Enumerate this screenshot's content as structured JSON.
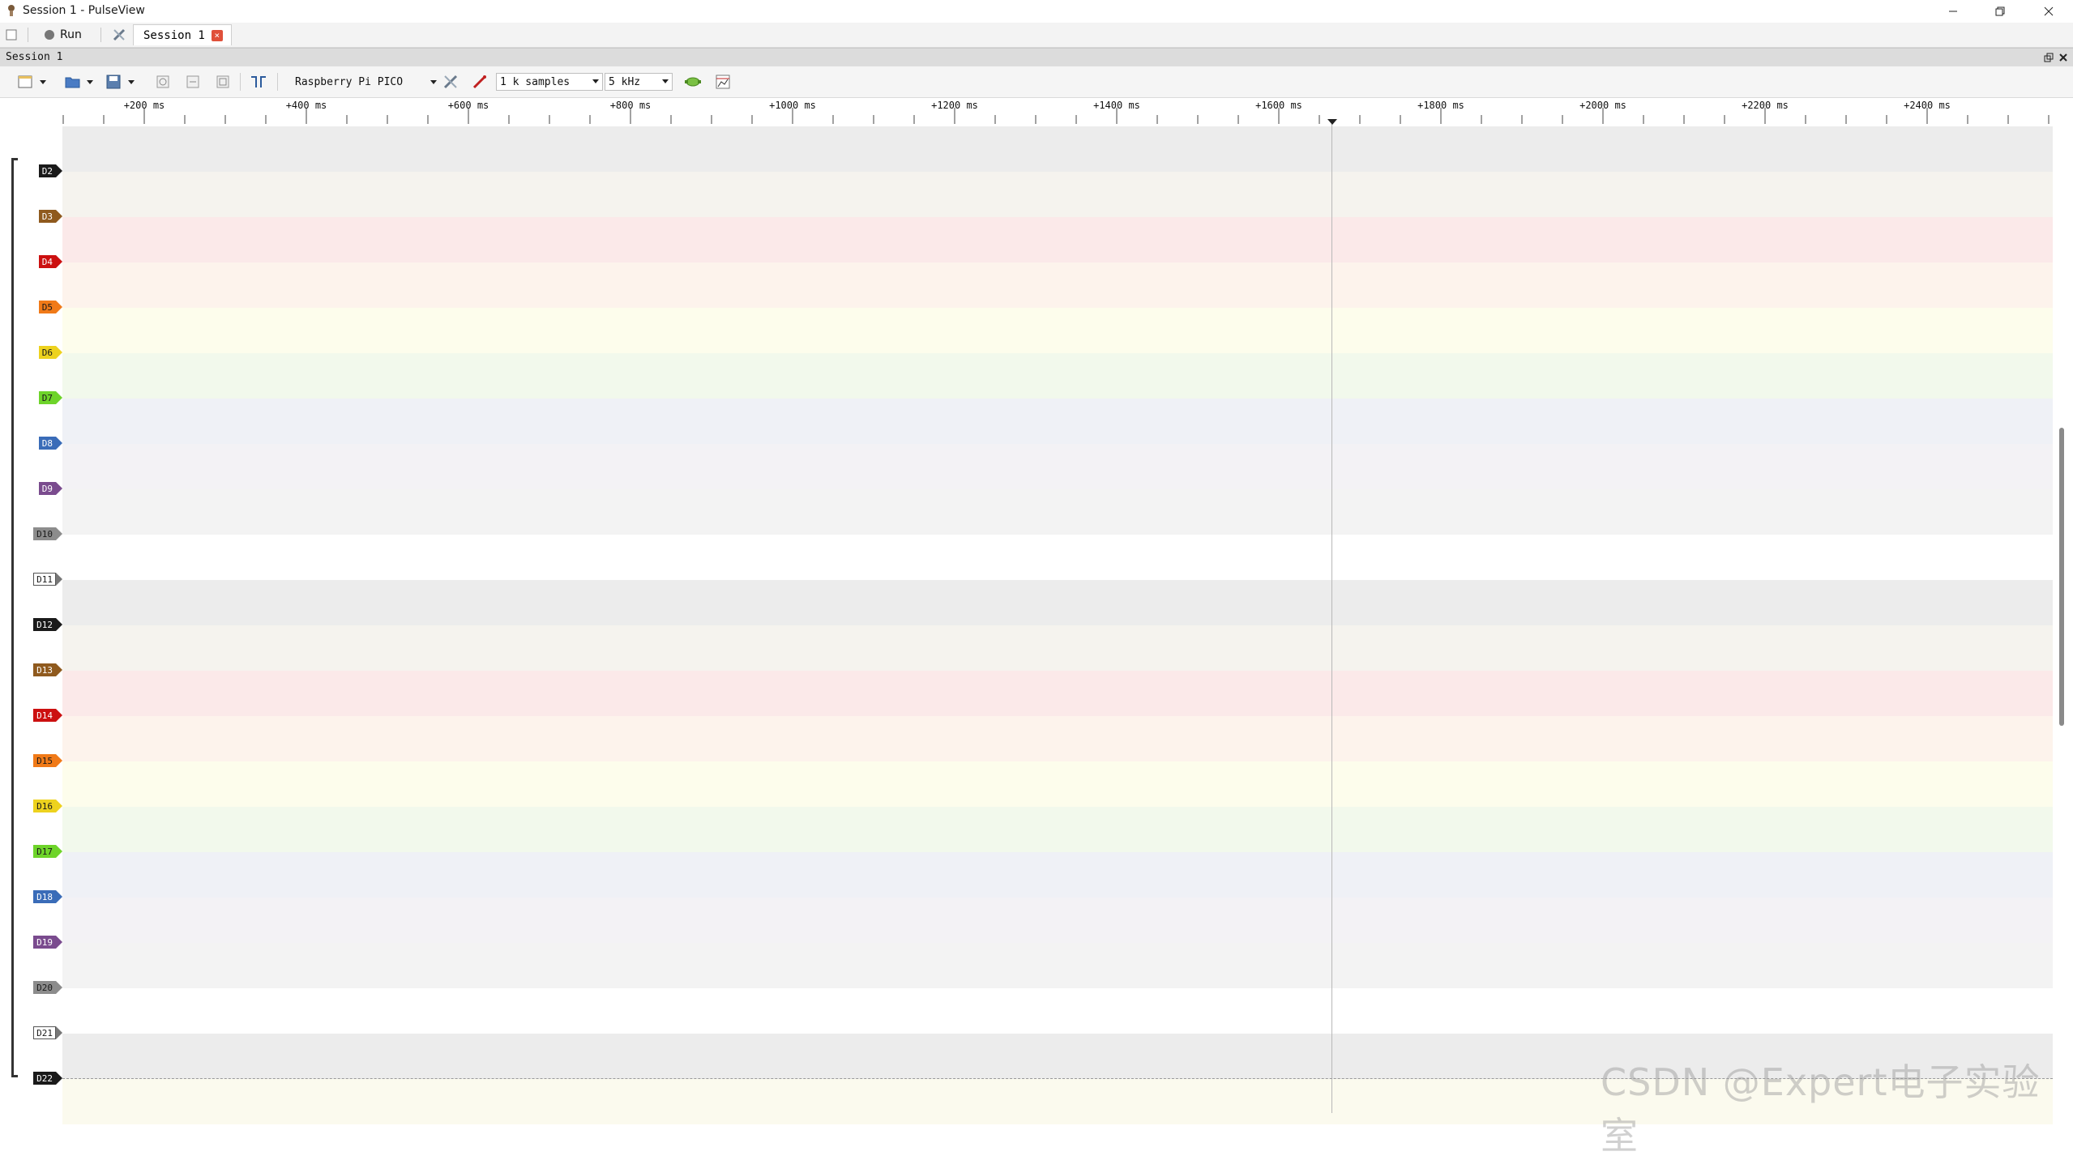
{
  "window": {
    "title": "Session 1 - PulseView"
  },
  "tabbar": {
    "run_label": "Run",
    "session_tab": "Session 1"
  },
  "dock": {
    "title": "Session 1"
  },
  "toolbar": {
    "device": "Raspberry Pi PICO",
    "samples": "1 k samples",
    "samplerate": "5 kHz"
  },
  "ruler": {
    "labels": [
      "+200 ms",
      "+400 ms",
      "+600 ms",
      "+800 ms",
      "+1000 ms",
      "+1200 ms",
      "+1400 ms",
      "+1600 ms",
      "+1800 ms",
      "+2000 ms",
      "+2200 ms",
      "+2400 ms"
    ]
  },
  "channels": [
    {
      "name": "D2",
      "color": "#1a1a1a",
      "text": "#ffffff"
    },
    {
      "name": "D3",
      "color": "#8f5a1e",
      "text": "#ffffff"
    },
    {
      "name": "D4",
      "color": "#cc1010",
      "text": "#ffffff"
    },
    {
      "name": "D5",
      "color": "#f07a18",
      "text": "#1a1a1a"
    },
    {
      "name": "D6",
      "color": "#edd21e",
      "text": "#1a1a1a"
    },
    {
      "name": "D7",
      "color": "#6ed42a",
      "text": "#1a1a1a"
    },
    {
      "name": "D8",
      "color": "#3a6cb8",
      "text": "#ffffff"
    },
    {
      "name": "D9",
      "color": "#7a4b8e",
      "text": "#ffffff"
    },
    {
      "name": "D10",
      "color": "#8c8c8c",
      "text": "#1a1a1a"
    },
    {
      "name": "D11",
      "color": "#ffffff",
      "text": "#1a1a1a"
    },
    {
      "name": "D12",
      "color": "#1a1a1a",
      "text": "#ffffff"
    },
    {
      "name": "D13",
      "color": "#8f5a1e",
      "text": "#ffffff"
    },
    {
      "name": "D14",
      "color": "#cc1010",
      "text": "#ffffff"
    },
    {
      "name": "D15",
      "color": "#f07a18",
      "text": "#1a1a1a"
    },
    {
      "name": "D16",
      "color": "#edd21e",
      "text": "#1a1a1a"
    },
    {
      "name": "D17",
      "color": "#6ed42a",
      "text": "#1a1a1a"
    },
    {
      "name": "D18",
      "color": "#3a6cb8",
      "text": "#ffffff"
    },
    {
      "name": "D19",
      "color": "#7a4b8e",
      "text": "#ffffff"
    },
    {
      "name": "D20",
      "color": "#8c8c8c",
      "text": "#1a1a1a"
    },
    {
      "name": "D21",
      "color": "#ffffff",
      "text": "#1a1a1a"
    },
    {
      "name": "D22",
      "color": "#1a1a1a",
      "text": "#ffffff"
    }
  ],
  "row_colors": [
    "#ececec",
    "#f5f3ee",
    "#fbe9e9",
    "#fdf3ec",
    "#fdfdec",
    "#f2f9ec",
    "#eff1f6",
    "#f3f2f5",
    "#f3f3f3",
    "#ffffff"
  ],
  "watermark": "CSDN @Expert电子实验室"
}
